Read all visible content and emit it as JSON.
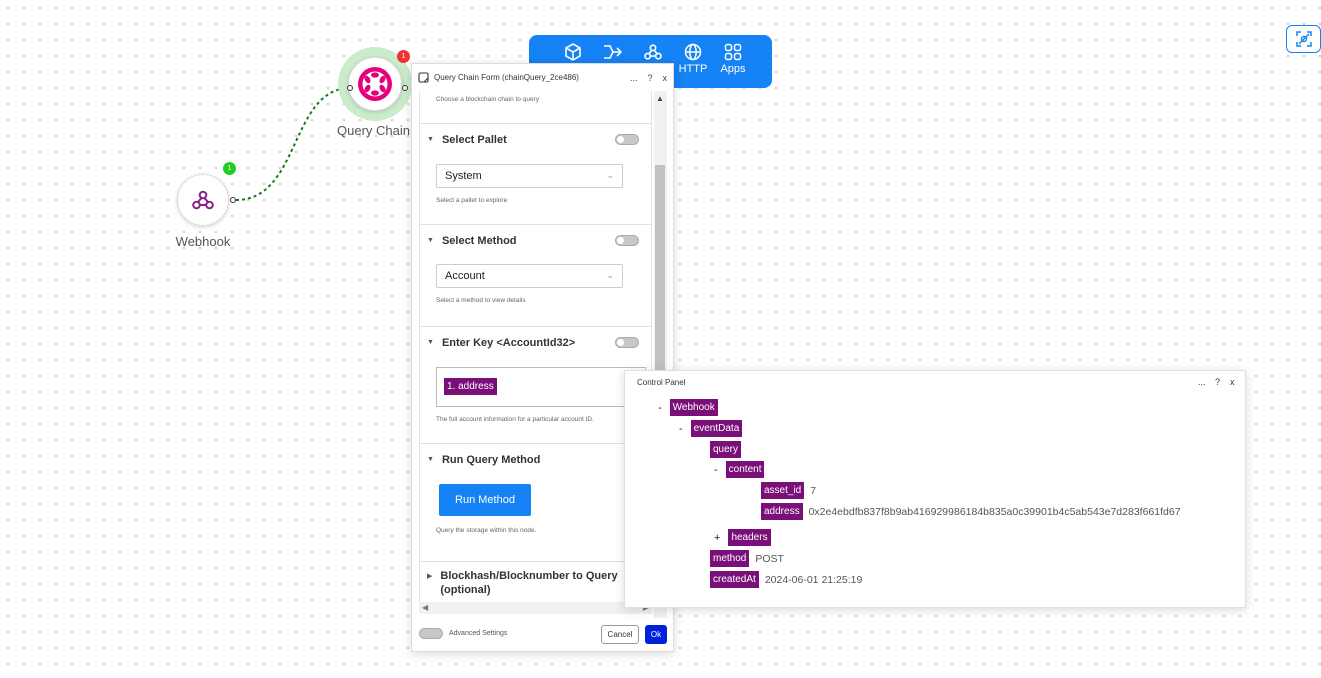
{
  "canvas": {
    "nodes": {
      "webhook": {
        "label": "Webhook",
        "badge": "1"
      },
      "query_chain": {
        "label": "Query Chain",
        "badge": "1"
      }
    }
  },
  "toolbar": {
    "items": [
      {
        "icon": "blockchain-icon",
        "label": ""
      },
      {
        "icon": "flow-icon",
        "label": ""
      },
      {
        "icon": "webhook-icon",
        "label": ""
      },
      {
        "icon": "globe-icon",
        "label": "HTTP"
      },
      {
        "icon": "apps-grid-icon",
        "label": "Apps"
      }
    ]
  },
  "form": {
    "title": "Query Chain Form (chainQuery_2ce486)",
    "header_buttons": {
      "more": "...",
      "help": "?",
      "close": "x"
    },
    "top_help": "Choose a blockchain chain to query",
    "pallet": {
      "heading": "Select Pallet",
      "value": "System",
      "help": "Select a pallet to explore"
    },
    "method": {
      "heading": "Select Method",
      "value": "Account",
      "help": "Select a method to view details"
    },
    "key": {
      "heading": "Enter Key <AccountId32>",
      "tag": "1. address",
      "help": "The full account information for a particular account ID."
    },
    "run": {
      "heading": "Run Query Method",
      "button": "Run Method",
      "help": "Query the storage within this node."
    },
    "blockhash": {
      "heading_line1": "Blockhash/Blocknumber to Query",
      "heading_line2": "(optional)"
    },
    "footer": {
      "advanced": "Advanced Settings",
      "cancel": "Cancel",
      "ok": "Ok"
    }
  },
  "control_panel": {
    "title": "Control Panel",
    "header_buttons": {
      "more": "...",
      "help": "?",
      "close": "x"
    },
    "tree": {
      "root": {
        "sign": "-",
        "key": "Webhook"
      },
      "eventData": {
        "sign": "-",
        "key": "eventData"
      },
      "query": {
        "key": "query"
      },
      "content": {
        "sign": "-",
        "key": "content"
      },
      "asset_id": {
        "key": "asset_id",
        "value": "7"
      },
      "address": {
        "key": "address",
        "value": "0x2e4ebdfb837f8b9ab416929986184b835a0c39901b4c5ab543e7d283f661fd67"
      },
      "headers": {
        "sign": "+",
        "key": "headers"
      },
      "method": {
        "key": "method",
        "value": "POST"
      },
      "createdAt": {
        "key": "createdAt",
        "value": "2024-06-01 21:25:19"
      }
    }
  },
  "colors": {
    "primary": "#1582f5",
    "tag": "#7a0f7a",
    "ok": "#0022dd",
    "badge_green": "#22cc22",
    "badge_red": "#ee3333",
    "polkadot": "#e6007a"
  }
}
